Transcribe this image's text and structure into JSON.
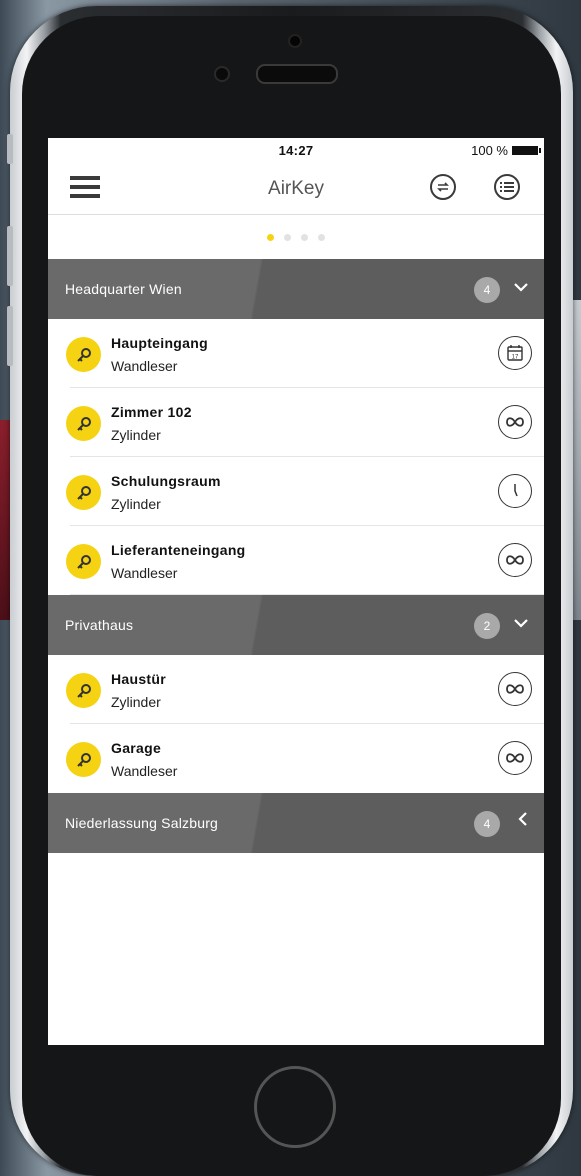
{
  "status_bar": {
    "time": "14:27",
    "battery": "100 %"
  },
  "nav": {
    "title": "AirKey"
  },
  "pager": {
    "dots": 4,
    "active": 0
  },
  "groups": [
    {
      "name": "Headquarter Wien",
      "count": "4",
      "chevron": "﹀",
      "items": [
        {
          "name": "Haupteingang",
          "type": "Wandleser",
          "icon": "calendar-icon",
          "date_digit": "17"
        },
        {
          "name": "Zimmer 102",
          "type": "Zylinder",
          "icon": "infinity-icon"
        },
        {
          "name": "Schulungsraum",
          "type": "Zylinder",
          "icon": "clock-icon"
        },
        {
          "name": "Lieferanteneingang",
          "type": "Wandleser",
          "icon": "infinity-icon"
        }
      ]
    },
    {
      "name": "Privathaus",
      "count": "2",
      "chevron": "﹀",
      "items": [
        {
          "name": "Haustür",
          "type": "Zylinder",
          "icon": "infinity-icon"
        },
        {
          "name": "Garage",
          "type": "Wandleser",
          "icon": "infinity-icon"
        }
      ]
    },
    {
      "name": "Niederlassung Salzburg",
      "count": "4",
      "chevron": "‹",
      "items": []
    }
  ],
  "colors": {
    "accent": "#f5d313",
    "header_bg": "#666666"
  }
}
